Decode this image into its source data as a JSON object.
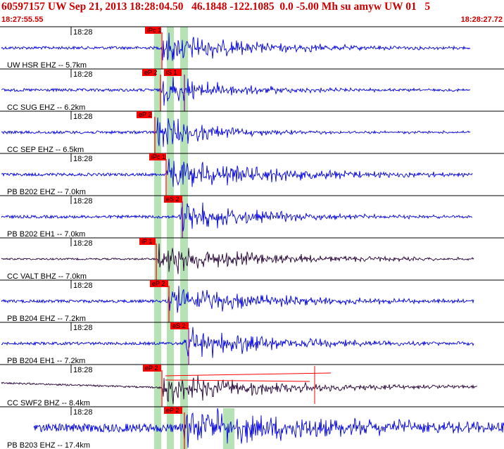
{
  "header": {
    "title": "60597157 UW Sep 21, 2013 18:28:04.50   46.1848 -122.1085  0.0 -5.00 Mh su amyw UW 01   5",
    "start_time": "18:27:55.55",
    "end_time": "18:28:27.72"
  },
  "colors": {
    "header_text": "#cc0000",
    "trace_blue": "#0000dd",
    "trace_dark": "#220033",
    "pick_box": "#ff0000",
    "pick_band": "#b6e3b6",
    "divider": "#000000"
  },
  "chart_data": {
    "type": "line",
    "x_unit": "time",
    "x_range": [
      "18:27:55.55",
      "18:28:27.72"
    ],
    "tick_label": "18:28",
    "channels": [
      {
        "station": "UW HSR EHZ -- 5.7km",
        "tick": "18:28",
        "picks": [
          "iPc 1"
        ],
        "trace_color": "blue"
      },
      {
        "station": "CC SUG EHZ -- 6.2km",
        "tick": "18:28",
        "picks": [
          "eP 2",
          "iS 1"
        ],
        "trace_color": "blue"
      },
      {
        "station": "CC SEP EHZ -- 6.5km",
        "tick": "18:28",
        "picks": [
          "eP 2"
        ],
        "trace_color": "blue"
      },
      {
        "station": "PB B202 EHZ -- 7.0km",
        "tick": "18:28",
        "picks": [
          "iPc 1"
        ],
        "trace_color": "blue"
      },
      {
        "station": "PB B202 EH1 -- 7.0km",
        "tick": "18:28",
        "picks": [
          "eS 2"
        ],
        "trace_color": "blue"
      },
      {
        "station": "CC VALT BHZ -- 7.0km",
        "tick": "18:28",
        "picks": [
          "iP 1"
        ],
        "trace_color": "dark"
      },
      {
        "station": "PB B204 EHZ -- 7.2km",
        "tick": "18:28",
        "picks": [
          "eP 2"
        ],
        "trace_color": "blue"
      },
      {
        "station": "PB B204 EH1 -- 7.2km",
        "tick": "18:28",
        "picks": [
          "eS 2"
        ],
        "trace_color": "blue"
      },
      {
        "station": "CC SWF2 BHZ -- 8.4km",
        "tick": "18:28",
        "picks": [
          "eP 2"
        ],
        "trace_color": "dark"
      },
      {
        "station": "PB B203 EHZ -- 17.4km",
        "tick": "18:28",
        "picks": [
          "eP 2"
        ],
        "trace_color": "blue"
      }
    ]
  }
}
